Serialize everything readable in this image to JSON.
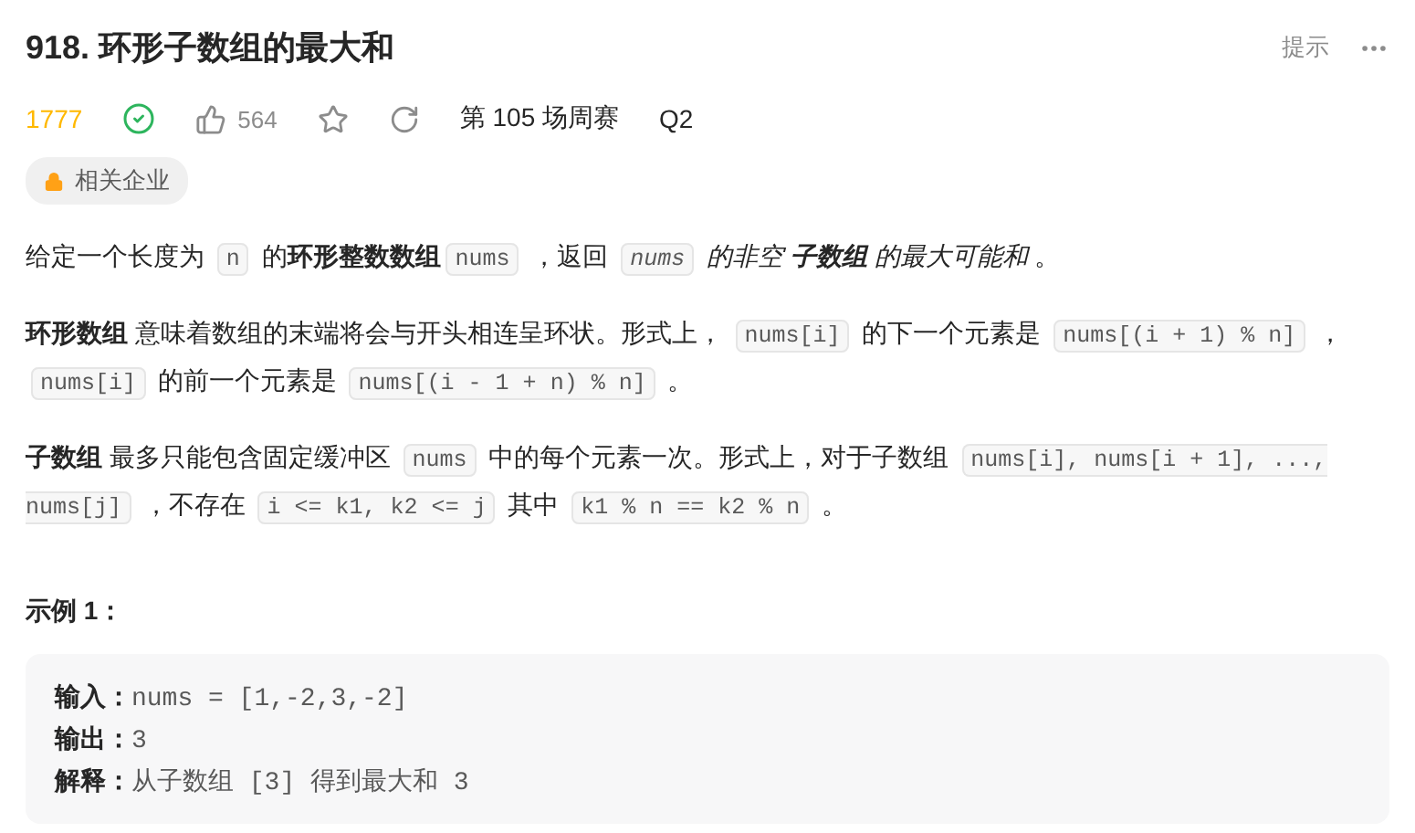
{
  "title": "918. 环形子数组的最大和",
  "hint_link": "提示",
  "meta": {
    "rating": "1777",
    "likes": "564",
    "contest": "第 105 场周赛",
    "question": "Q2"
  },
  "tag": "相关企业",
  "paragraphs": [
    {
      "segments": [
        {
          "kind": "text",
          "text": "给定一个长度为 "
        },
        {
          "kind": "code",
          "text": "n"
        },
        {
          "kind": "text",
          "text": " 的"
        },
        {
          "kind": "bold",
          "text": "环形整数数组"
        },
        {
          "kind": "code",
          "text": "nums"
        },
        {
          "kind": "text",
          "text": " ，返回 "
        },
        {
          "kind": "code-italic",
          "text": "nums"
        },
        {
          "kind": "italic",
          "text": " 的非空 "
        },
        {
          "kind": "bold-italic",
          "text": "子数组"
        },
        {
          "kind": "italic",
          "text": " 的最大可能和"
        },
        {
          "kind": "text",
          "text": " 。"
        }
      ]
    },
    {
      "segments": [
        {
          "kind": "bold",
          "text": "环形数组"
        },
        {
          "kind": "text",
          "text": " 意味着数组的末端将会与开头相连呈环状。形式上， "
        },
        {
          "kind": "code",
          "text": "nums[i]"
        },
        {
          "kind": "text",
          "text": " 的下一个元素是 "
        },
        {
          "kind": "code",
          "text": "nums[(i + 1) % n]"
        },
        {
          "kind": "text",
          "text": " ， "
        },
        {
          "kind": "code",
          "text": "nums[i]"
        },
        {
          "kind": "text",
          "text": " 的前一个元素是 "
        },
        {
          "kind": "code",
          "text": "nums[(i - 1 + n) % n]"
        },
        {
          "kind": "text",
          "text": " 。"
        }
      ]
    },
    {
      "segments": [
        {
          "kind": "bold",
          "text": "子数组"
        },
        {
          "kind": "text",
          "text": " 最多只能包含固定缓冲区 "
        },
        {
          "kind": "code",
          "text": "nums"
        },
        {
          "kind": "text",
          "text": " 中的每个元素一次。形式上，对于子数组 "
        },
        {
          "kind": "code",
          "text": "nums[i], nums[i + 1], ..., nums[j]"
        },
        {
          "kind": "text",
          "text": " ，不存在 "
        },
        {
          "kind": "code",
          "text": "i <= k1, k2 <= j"
        },
        {
          "kind": "text",
          "text": " 其中 "
        },
        {
          "kind": "code",
          "text": "k1 % n == k2 % n"
        },
        {
          "kind": "text",
          "text": " 。"
        }
      ]
    }
  ],
  "example": {
    "title": "示例 1：",
    "lines": [
      {
        "label": "输入：",
        "value": "nums = [1,-2,3,-2]"
      },
      {
        "label": "输出：",
        "value": "3"
      },
      {
        "label": "解释：",
        "value": "从子数组 [3] 得到最大和 3"
      }
    ]
  }
}
